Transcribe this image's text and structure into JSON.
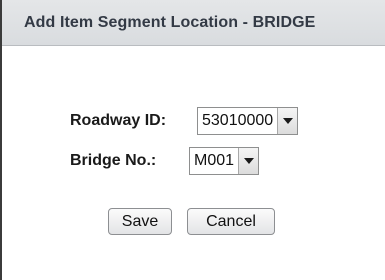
{
  "dialog": {
    "title": "Add Item Segment Location - BRIDGE"
  },
  "form": {
    "roadway": {
      "label": "Roadway ID:",
      "value": "53010000"
    },
    "bridge": {
      "label": "Bridge No.:",
      "value": "M001"
    }
  },
  "actions": {
    "save_label": "Save",
    "cancel_label": "Cancel"
  },
  "icons": {
    "dropdown": "chevron-down-icon"
  }
}
